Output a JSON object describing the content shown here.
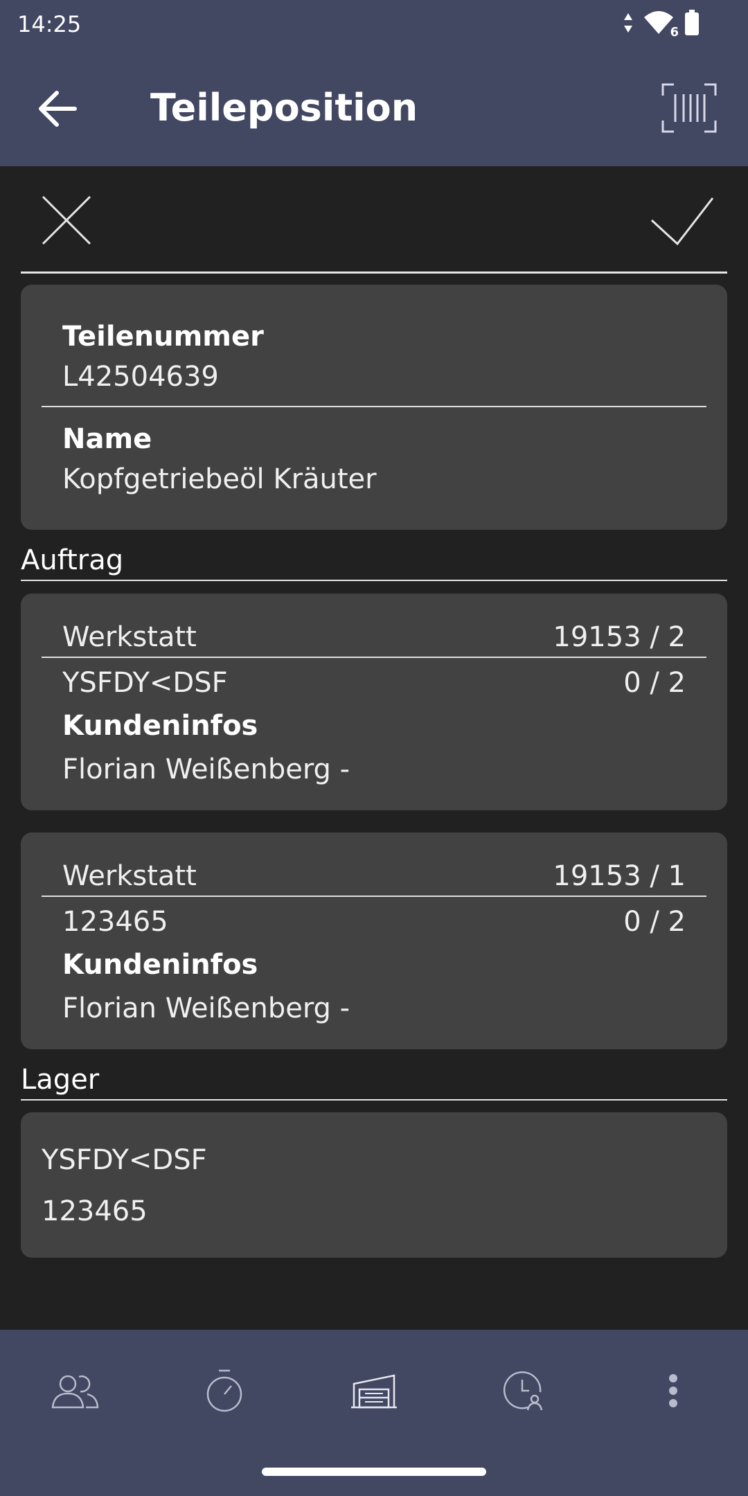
{
  "status_bar": {
    "time": "14:25",
    "icons": [
      "data-arrows-icon",
      "wifi-icon",
      "battery-icon"
    ],
    "wifi_badge": "6"
  },
  "app_bar": {
    "title": "Teileposition",
    "back_icon": "arrow-left-icon",
    "scan_icon": "barcode-scan-icon"
  },
  "actions": {
    "cancel_icon": "close-icon",
    "confirm_icon": "check-icon"
  },
  "part": {
    "number_label": "Teilenummer",
    "number_value": "L42504639",
    "name_label": "Name",
    "name_value": "Kopfgetriebeöl Kräuter"
  },
  "auftrag": {
    "section_title": "Auftrag",
    "orders": [
      {
        "label": "Werkstatt",
        "order_no": "19153 / 2",
        "code": "YSFDY<DSF",
        "qty": "0 / 2",
        "info_label": "Kundeninfos",
        "customer": "Florian Weißenberg -"
      },
      {
        "label": "Werkstatt",
        "order_no": "19153 / 1",
        "code": "123465",
        "qty": "0 / 2",
        "info_label": "Kundeninfos",
        "customer": "Florian Weißenberg -"
      }
    ]
  },
  "lager": {
    "section_title": "Lager",
    "items": [
      "YSFDY<DSF",
      "123465"
    ]
  },
  "bottom_nav": {
    "items": [
      "people-icon",
      "stopwatch-icon",
      "warehouse-icon",
      "clock-user-icon",
      "more-vert-icon"
    ]
  },
  "colors": {
    "bar": "#424762",
    "background": "#212121",
    "card": "#424242"
  }
}
